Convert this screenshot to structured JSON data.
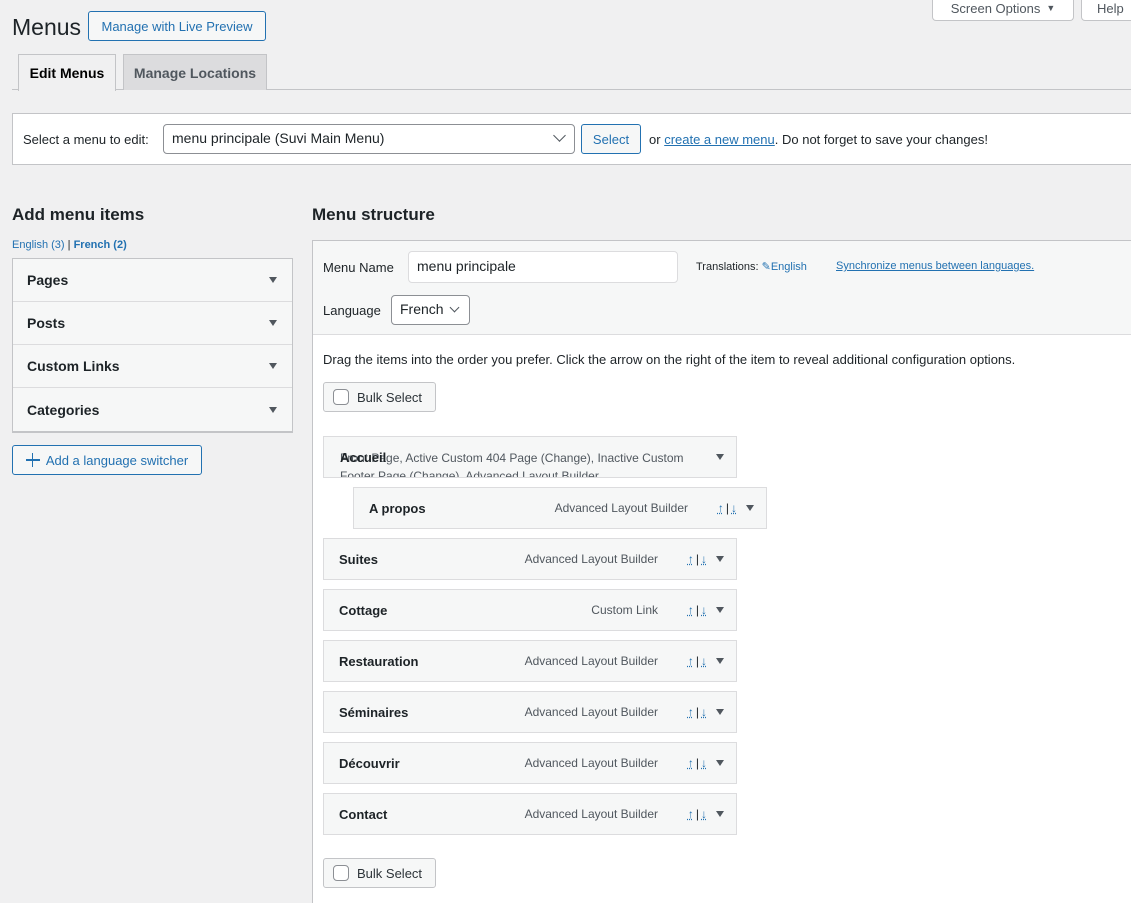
{
  "page": {
    "title": "Menus",
    "live_preview_label": "Manage with Live Preview"
  },
  "screen_meta": {
    "screen_options_label": "Screen Options",
    "help_label": "Help"
  },
  "nav_tabs": [
    {
      "label": "Edit Menus",
      "active": true
    },
    {
      "label": "Manage Locations",
      "active": false
    }
  ],
  "manage_menus": {
    "label": "Select a menu to edit:",
    "selected_menu": "menu principale (Suvi Main Menu)",
    "select_button": "Select",
    "or_text": "or",
    "create_link": "create a new menu",
    "save_reminder": ". Do not forget to save your changes!"
  },
  "add_items": {
    "title": "Add menu items",
    "lang_english": "English (3)",
    "lang_sep": "|",
    "lang_french": "French (2)",
    "panels": [
      "Pages",
      "Posts",
      "Custom Links",
      "Categories"
    ],
    "language_switcher_label": "Add a language switcher"
  },
  "structure": {
    "title": "Menu structure",
    "menu_name_label": "Menu Name",
    "menu_name_value": "menu principale",
    "translations_label": "Translations:",
    "translations_lang": "English",
    "sync_link": "Synchronize menus between languages.",
    "language_label": "Language",
    "language_value": "French",
    "drag_instructions": "Drag the items into the order you prefer. Click the arrow on the right of the item to reveal additional configuration options.",
    "bulk_select_label": "Bulk Select",
    "first_item": {
      "title": "Accueil",
      "overlap_text": "Front Page, Active Custom 404 Page (Change), Inactive Custom Footer Page (Change), Advanced Layout Builder"
    },
    "items": [
      {
        "title": "A propos",
        "type": "Advanced Layout Builder"
      },
      {
        "title": "Suites",
        "type": "Advanced Layout Builder"
      },
      {
        "title": "Cottage",
        "type": "Custom Link"
      },
      {
        "title": "Restauration",
        "type": "Advanced Layout Builder"
      },
      {
        "title": "Séminaires",
        "type": "Advanced Layout Builder"
      },
      {
        "title": "Découvrir",
        "type": "Advanced Layout Builder"
      },
      {
        "title": "Contact",
        "type": "Advanced Layout Builder"
      }
    ],
    "move_up_glyph": "↑",
    "move_sep": "|",
    "move_down_glyph": "↓"
  },
  "icons": {
    "dropdown": "triangle-down-icon",
    "pencil": "✎",
    "add": "plus-icon"
  },
  "colors": {
    "accent": "#2271b1",
    "background": "#f0f0f1",
    "text": "#1d2327"
  }
}
